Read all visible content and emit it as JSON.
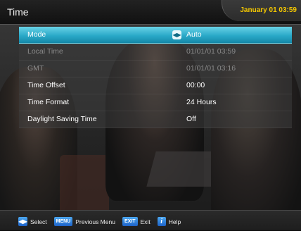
{
  "header": {
    "title": "Time",
    "clock": "January 01 03:59"
  },
  "menu": {
    "rows": [
      {
        "label": "Mode",
        "value": "Auto",
        "selected": true
      },
      {
        "label": "Local Time",
        "value": "01/01/01 03:59",
        "disabled": true
      },
      {
        "label": "GMT",
        "value": "01/01/01 03:16",
        "disabled": true
      },
      {
        "label": "Time Offset",
        "value": "00:00"
      },
      {
        "label": "Time Format",
        "value": "24 Hours"
      },
      {
        "label": "Daylight Saving Time",
        "value": "Off"
      }
    ]
  },
  "help": {
    "select_icon": "◀▶",
    "select": "Select",
    "menu_key": "MENU",
    "previous_menu": "Previous Menu",
    "exit_key": "EXIT",
    "exit": "Exit",
    "info_key": "i",
    "help": "Help"
  },
  "colors": {
    "accent": "#2aa9c8",
    "clock": "#f5c800",
    "key": "#1d62c8"
  },
  "icons": {
    "mode_arrows": "left-right-arrow-icon",
    "info": "info-icon"
  }
}
